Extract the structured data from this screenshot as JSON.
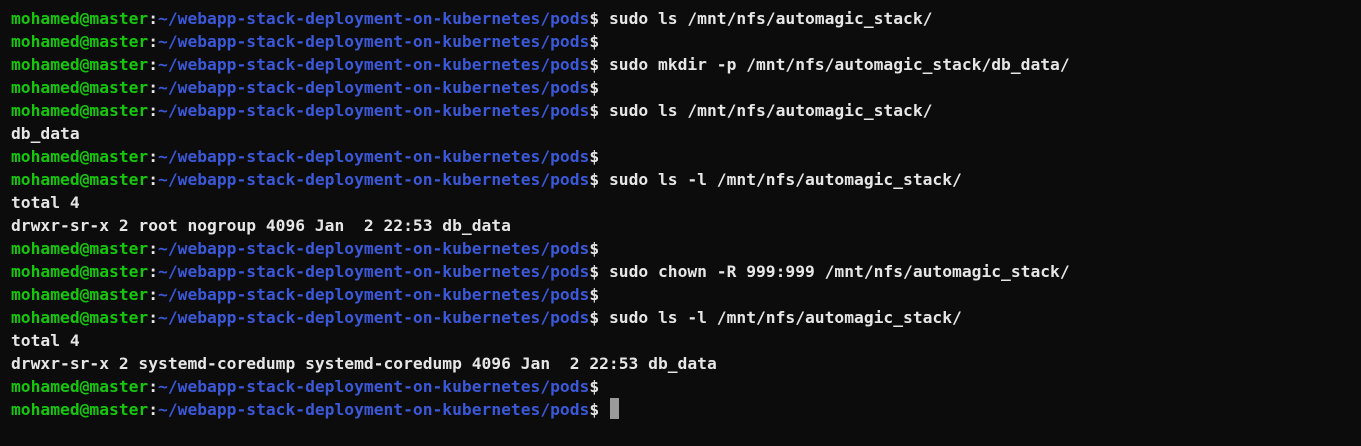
{
  "prompt": {
    "user_host": "mohamed@master",
    "separator": ":",
    "path": "~/webapp-stack-deployment-on-kubernetes/pods",
    "symbol": "$"
  },
  "lines": [
    {
      "type": "prompt",
      "command": " sudo ls /mnt/nfs/automagic_stack/"
    },
    {
      "type": "prompt",
      "command": ""
    },
    {
      "type": "prompt",
      "command": " sudo mkdir -p /mnt/nfs/automagic_stack/db_data/"
    },
    {
      "type": "prompt",
      "command": ""
    },
    {
      "type": "prompt",
      "command": " sudo ls /mnt/nfs/automagic_stack/"
    },
    {
      "type": "output",
      "text": "db_data"
    },
    {
      "type": "prompt",
      "command": ""
    },
    {
      "type": "prompt",
      "command": " sudo ls -l /mnt/nfs/automagic_stack/"
    },
    {
      "type": "output",
      "text": "total 4"
    },
    {
      "type": "output",
      "text": "drwxr-sr-x 2 root nogroup 4096 Jan  2 22:53 db_data"
    },
    {
      "type": "prompt",
      "command": ""
    },
    {
      "type": "prompt",
      "command": " sudo chown -R 999:999 /mnt/nfs/automagic_stack/"
    },
    {
      "type": "prompt",
      "command": ""
    },
    {
      "type": "prompt",
      "command": " sudo ls -l /mnt/nfs/automagic_stack/"
    },
    {
      "type": "output",
      "text": "total 4"
    },
    {
      "type": "output",
      "text": "drwxr-sr-x 2 systemd-coredump systemd-coredump 4096 Jan  2 22:53 db_data"
    },
    {
      "type": "prompt",
      "command": ""
    },
    {
      "type": "prompt",
      "command": " ",
      "cursor": true
    }
  ],
  "colors": {
    "background": "#0c0c0c",
    "user_host": "#16c60c",
    "path": "#3b58d8",
    "text": "#e6e6e6",
    "cursor": "#9a9a9a"
  }
}
